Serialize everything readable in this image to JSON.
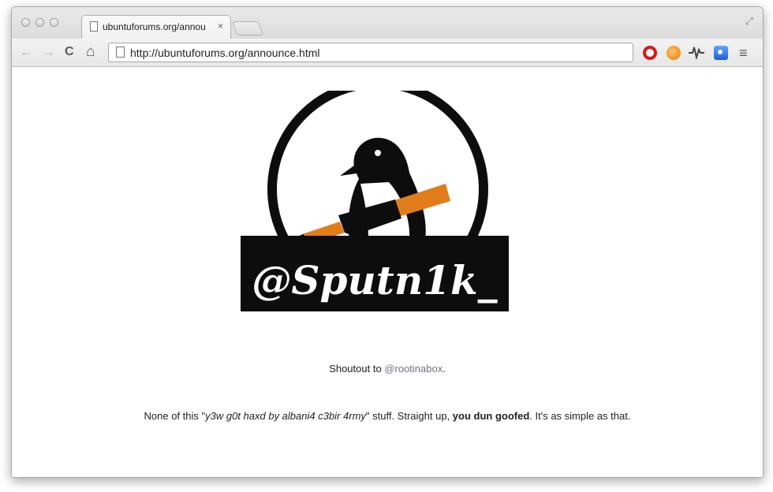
{
  "browser": {
    "tab": {
      "title": "ubuntuforums.org/annou",
      "close": "×"
    },
    "nav": {
      "back": "←",
      "forward": "→",
      "reload": "C",
      "home": "⌂"
    },
    "address": {
      "url": "http://ubuntuforums.org/announce.html"
    },
    "menu_icon": "≡",
    "fullscreen_icon": "⤢",
    "extensions": [
      "opera-icon",
      "orange-extension-icon",
      "pulse-icon",
      "blue-extension-icon"
    ]
  },
  "page": {
    "logo": {
      "text": "@Sputn1k_",
      "colors": {
        "ink": "#0d0d0d",
        "stock": "#e27d1c"
      }
    },
    "shoutout": {
      "prefix": "Shoutout to ",
      "link": "@rootinabox",
      "suffix": "."
    },
    "message": {
      "part1": "None of this \"",
      "italic": "y3w g0t haxd by albani4 c3bir 4rmy",
      "part2": "\" stuff. Straight up, ",
      "bold": "you dun goofed",
      "part3": ". It's as simple as that."
    }
  }
}
